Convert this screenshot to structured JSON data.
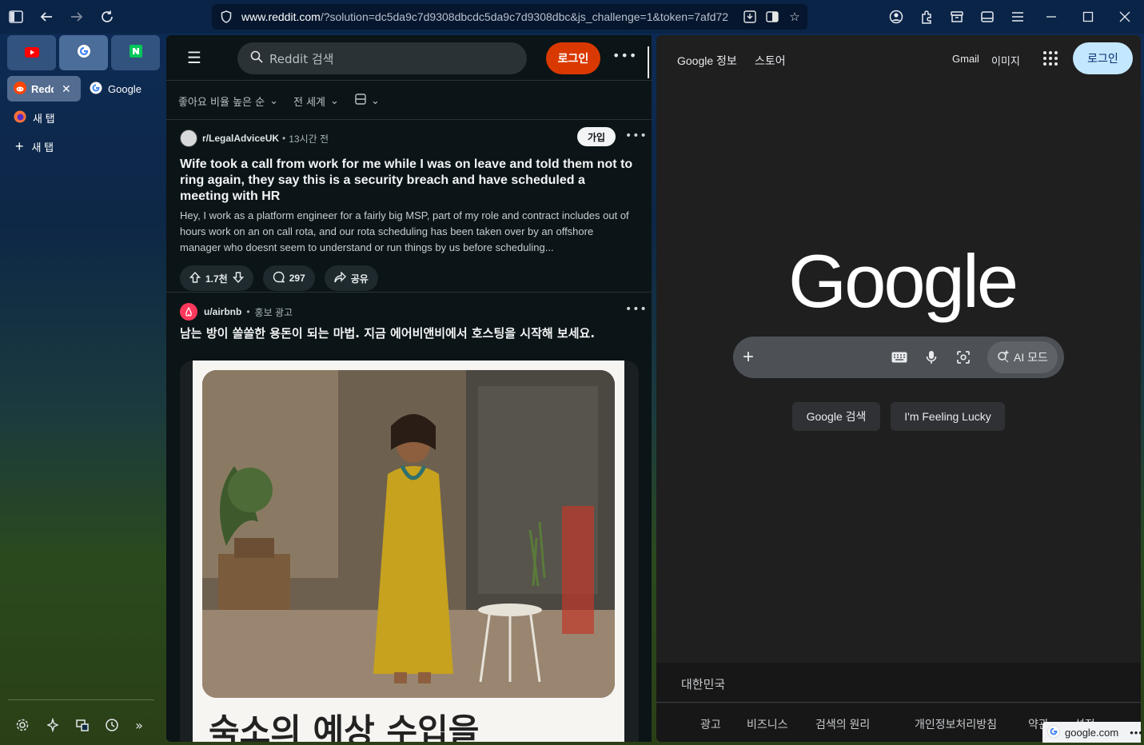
{
  "browser": {
    "url_domain": "www.reddit.com",
    "url_rest": "/?solution=dc5da9c7d9308dbcdc5da9c7d9308dbc&js_challenge=1&token=7afd72",
    "pinned_tabs": [
      "youtube-icon",
      "google-icon",
      "naver-icon"
    ],
    "tabs": [
      {
        "label": "Reddit",
        "close": "✕"
      },
      {
        "label": "Google"
      },
      {
        "label": "새 탭"
      }
    ],
    "new_tab_label": "새 탭"
  },
  "reddit": {
    "search_placeholder": "Reddit 검색",
    "login_label": "로그인",
    "sort_label": "좋아요 비율 높은 순",
    "region_label": "전 세계",
    "post1": {
      "subreddit": "r/LegalAdviceUK",
      "time": "13시간 전",
      "join_label": "가입",
      "title": "Wife took a call from work for me while I was on leave and told them not to ring again, they say this is a security breach and have scheduled a meeting with HR",
      "body": "Hey, I work as a platform engineer for a fairly big MSP, part of my role and contract includes out of hours work on an on call rota, and our rota scheduling has been taken over by an offshore manager who doesnt seem to understand or run things by us before scheduling...",
      "votes": "1.7천",
      "comments": "297",
      "share_label": "공유"
    },
    "ad": {
      "user": "u/airbnb",
      "tag": "홍보 광고",
      "title": "남는 방이 쏠쏠한 용돈이 되는 마법. 지금 에어비앤비에서 호스팅을 시작해 보세요.",
      "headline": "숙소의 예상 수입을"
    }
  },
  "google": {
    "about": "Google 정보",
    "store": "스토어",
    "gmail": "Gmail",
    "images": "이미지",
    "login": "로그인",
    "logo": "Google",
    "ai_mode": "AI 모드",
    "search_btn": "Google 검색",
    "lucky_btn": "I'm Feeling Lucky",
    "country": "대한민국",
    "footer_links": [
      "광고",
      "비즈니스",
      "검색의 원리",
      "개인정보처리방침",
      "약관",
      "설정"
    ]
  },
  "status": {
    "domain": "google.com"
  }
}
